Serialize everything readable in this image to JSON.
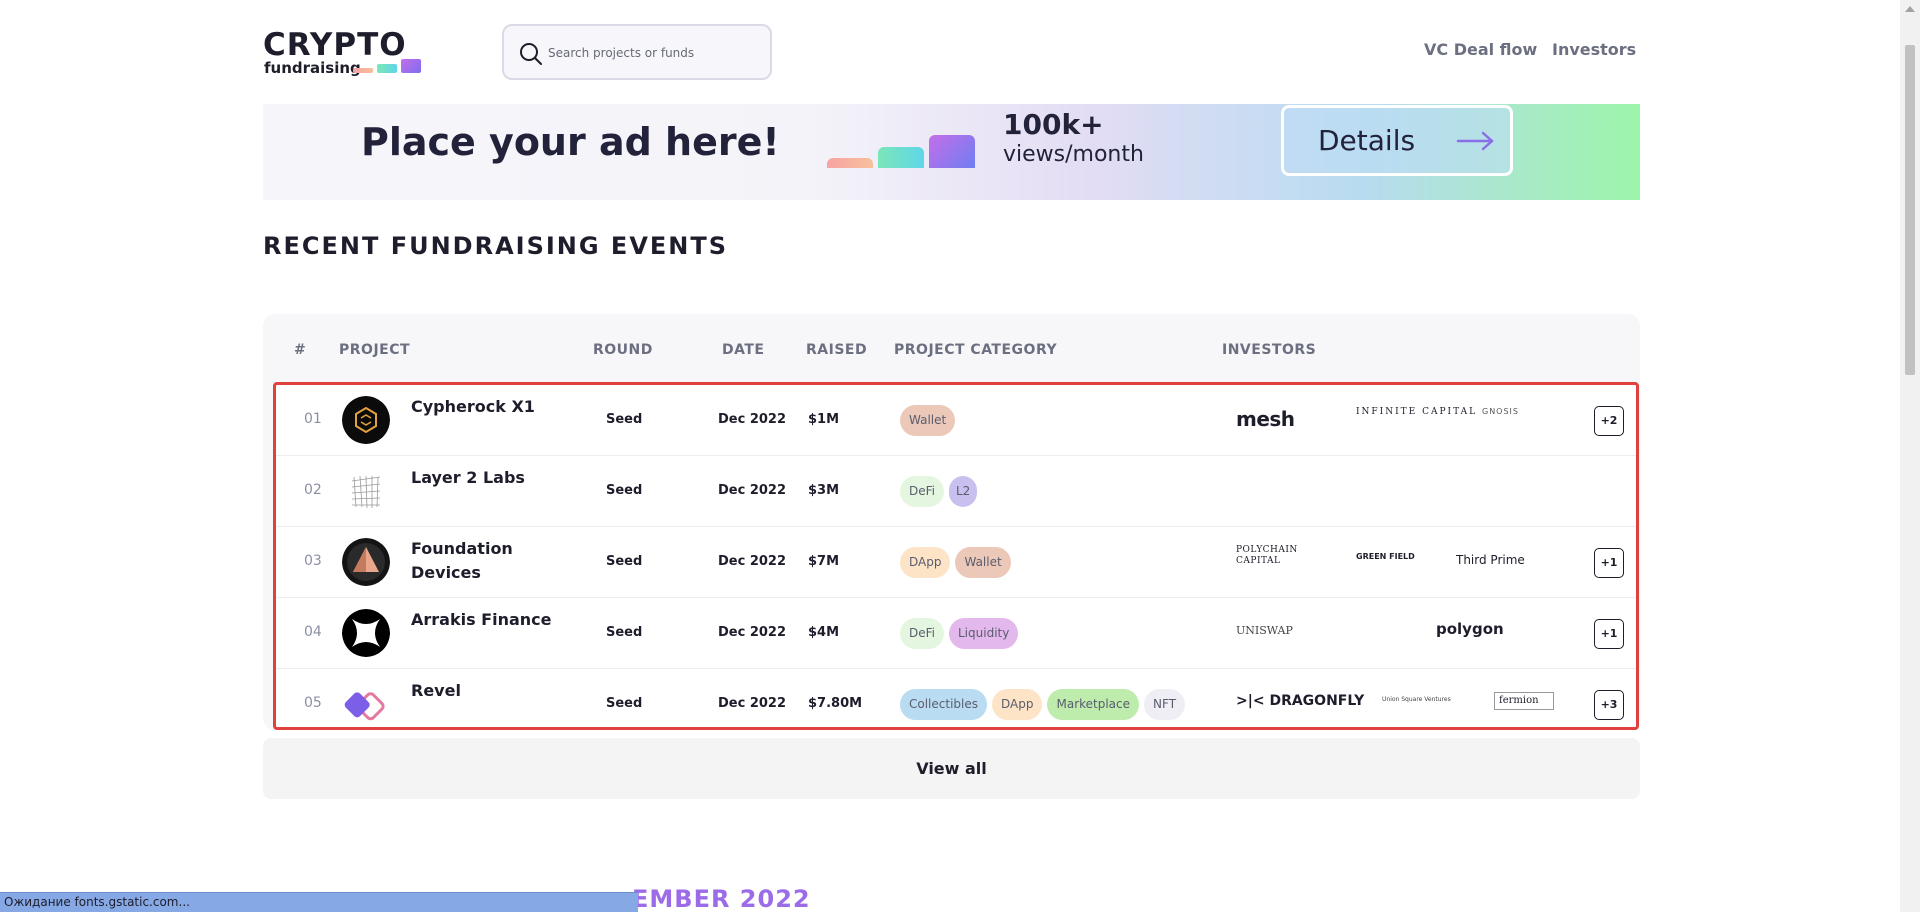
{
  "header": {
    "logo_title": "CRYPTO",
    "logo_sub": "fundraising",
    "search_placeholder": "Search projects or funds",
    "nav": [
      "VC Deal flow",
      "Investors"
    ]
  },
  "ad": {
    "title": "Place your ad here!",
    "views_number": "100k+",
    "views_label": "views/month",
    "button_label": "Details"
  },
  "section_title": "RECENT FUNDRAISING EVENTS",
  "table": {
    "headers": [
      "#",
      "PROJECT",
      "ROUND",
      "DATE",
      "RAISED",
      "PROJECT CATEGORY",
      "INVESTORS"
    ],
    "rows": [
      {
        "num": "01",
        "name": "Cypherock X1",
        "round": "Seed",
        "date": "Dec 2022",
        "raised": "$1M",
        "categories": [
          "Wallet"
        ],
        "investors": [
          "mesh",
          "INFINITE CAPITAL",
          "GNOSIS"
        ],
        "more": "+2"
      },
      {
        "num": "02",
        "name": "Layer 2 Labs",
        "round": "Seed",
        "date": "Dec 2022",
        "raised": "$3M",
        "categories": [
          "DeFi",
          "L2"
        ],
        "investors": [],
        "more": ""
      },
      {
        "num": "03",
        "name": "Foundation Devices",
        "round": "Seed",
        "date": "Dec 2022",
        "raised": "$7M",
        "categories": [
          "DApp",
          "Wallet"
        ],
        "investors": [
          "POLYCHAIN CAPITAL",
          "GREEN FIELD",
          "Third Prime"
        ],
        "more": "+1"
      },
      {
        "num": "04",
        "name": "Arrakis Finance",
        "round": "Seed",
        "date": "Dec 2022",
        "raised": "$4M",
        "categories": [
          "DeFi",
          "Liquidity"
        ],
        "investors": [
          "UNISWAP",
          "polygon"
        ],
        "more": "+1"
      },
      {
        "num": "05",
        "name": "Revel",
        "round": "Seed",
        "date": "Dec 2022",
        "raised": "$7.80M",
        "categories": [
          "Collectibles",
          "DApp",
          "Marketplace",
          "NFT"
        ],
        "investors": [
          ">|< DRAGONFLY",
          "Union Square Ventures",
          "fermion"
        ],
        "more": "+3"
      }
    ]
  },
  "view_all_label": "View all",
  "next_section_partial": "EMBER 2022",
  "status_bar": "Ожидание fonts.gstatic.com...",
  "colors": {
    "tag_wallet": "#ecc8b8",
    "tag_defi": "#e4f6df",
    "tag_l2": "#c9c0f0",
    "tag_dapp": "#fde4c6",
    "tag_liquidity": "#e3b8ec",
    "tag_collectibles": "#b9dcf3",
    "tag_marketplace": "#bdecac",
    "tag_nft": "#eeeef4",
    "highlight_border": "#e0413d"
  }
}
